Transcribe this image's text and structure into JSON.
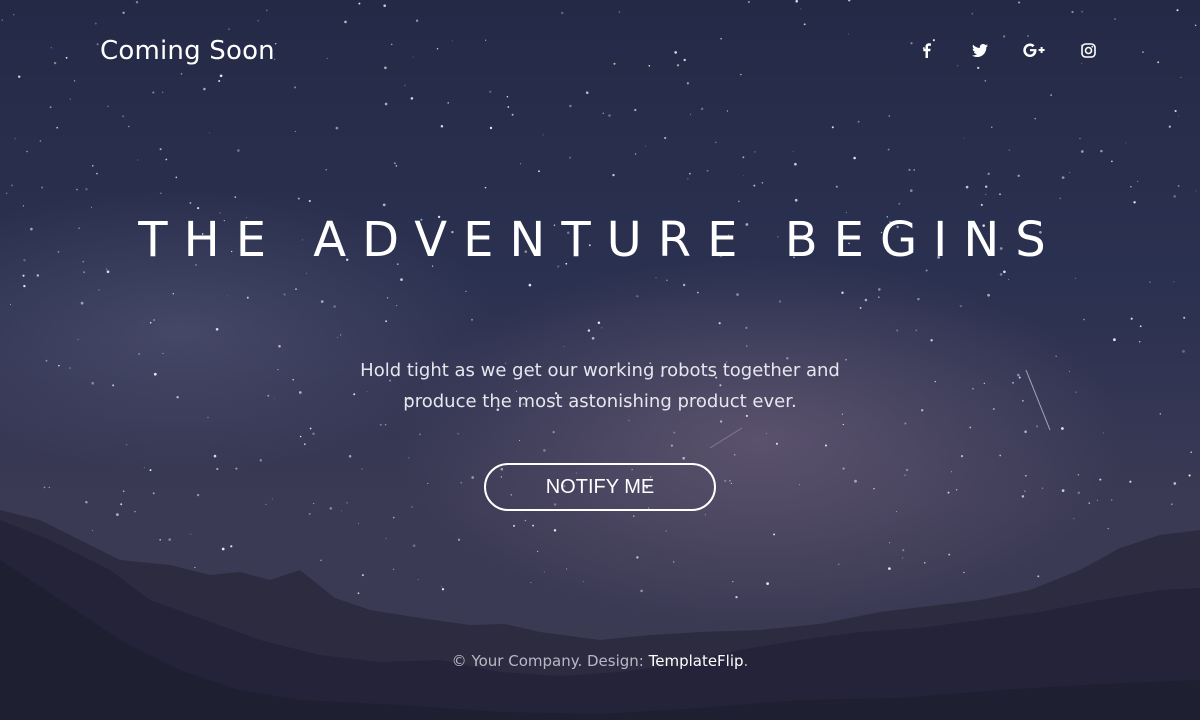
{
  "header": {
    "brand": "Coming Soon"
  },
  "social": [
    {
      "name": "facebook",
      "icon": "facebook-icon"
    },
    {
      "name": "twitter",
      "icon": "twitter-icon"
    },
    {
      "name": "google-plus",
      "icon": "google-plus-icon"
    },
    {
      "name": "instagram",
      "icon": "instagram-icon"
    }
  ],
  "hero": {
    "headline": "THE ADVENTURE BEGINS",
    "tagline_line1": "Hold tight as we get our working robots together and",
    "tagline_line2": "produce the most astonishing product ever.",
    "cta_label": "NOTIFY ME"
  },
  "footer": {
    "copyright": "© Your Company. Design: ",
    "designer_link": "TemplateFlip",
    "period": "."
  },
  "colors": {
    "sky_top": "#242a46",
    "sky_bottom": "#3b3a52",
    "text": "#ffffff",
    "footer_text": "#b9b9c6"
  }
}
